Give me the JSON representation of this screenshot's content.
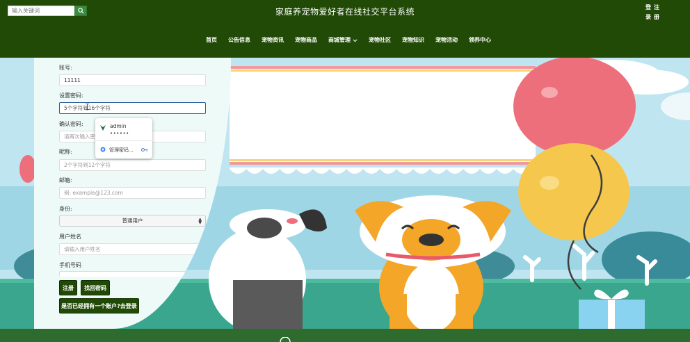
{
  "header": {
    "search_placeholder": "输入关键词",
    "title": "家庭养宠物爱好者在线社交平台系统",
    "auth": [
      "登",
      "注",
      "录",
      "册"
    ],
    "nav": [
      {
        "label": "首页"
      },
      {
        "label": "公告信息"
      },
      {
        "label": "宠物资讯"
      },
      {
        "label": "宠物商品"
      },
      {
        "label": "商城管理",
        "has_dropdown": true
      },
      {
        "label": "宠物社区"
      },
      {
        "label": "宠物知识"
      },
      {
        "label": "宠物活动"
      },
      {
        "label": "领养中心"
      }
    ]
  },
  "form": {
    "account": {
      "label": "账号:",
      "value": "11111"
    },
    "password": {
      "label": "设置密码:",
      "placeholder": "5个字符到16个字符"
    },
    "confirm": {
      "label": "确认密码:",
      "placeholder": "请再次输入密码"
    },
    "nickname": {
      "label": "昵称:",
      "placeholder": "2个字符到12个字符"
    },
    "email": {
      "label": "邮箱:",
      "placeholder": "例: example@123.com"
    },
    "role": {
      "label": "身份:",
      "selected": "普通用户"
    },
    "username": {
      "label": "用户姓名",
      "placeholder": "请输入用户姓名"
    },
    "phone": {
      "label": "手机号码"
    },
    "register_button": "注册",
    "recover_button": "找回密码",
    "login_link": "是否已经拥有一个账户?去登录"
  },
  "autofill": {
    "username": "admin",
    "password_mask": "••••••",
    "manage_label": "管理密码..."
  },
  "colors": {
    "header_bg": "#214a06",
    "footer_bg": "#2d6b2f",
    "panel_bg": "#eefaf8",
    "button_bg": "#214a06"
  }
}
